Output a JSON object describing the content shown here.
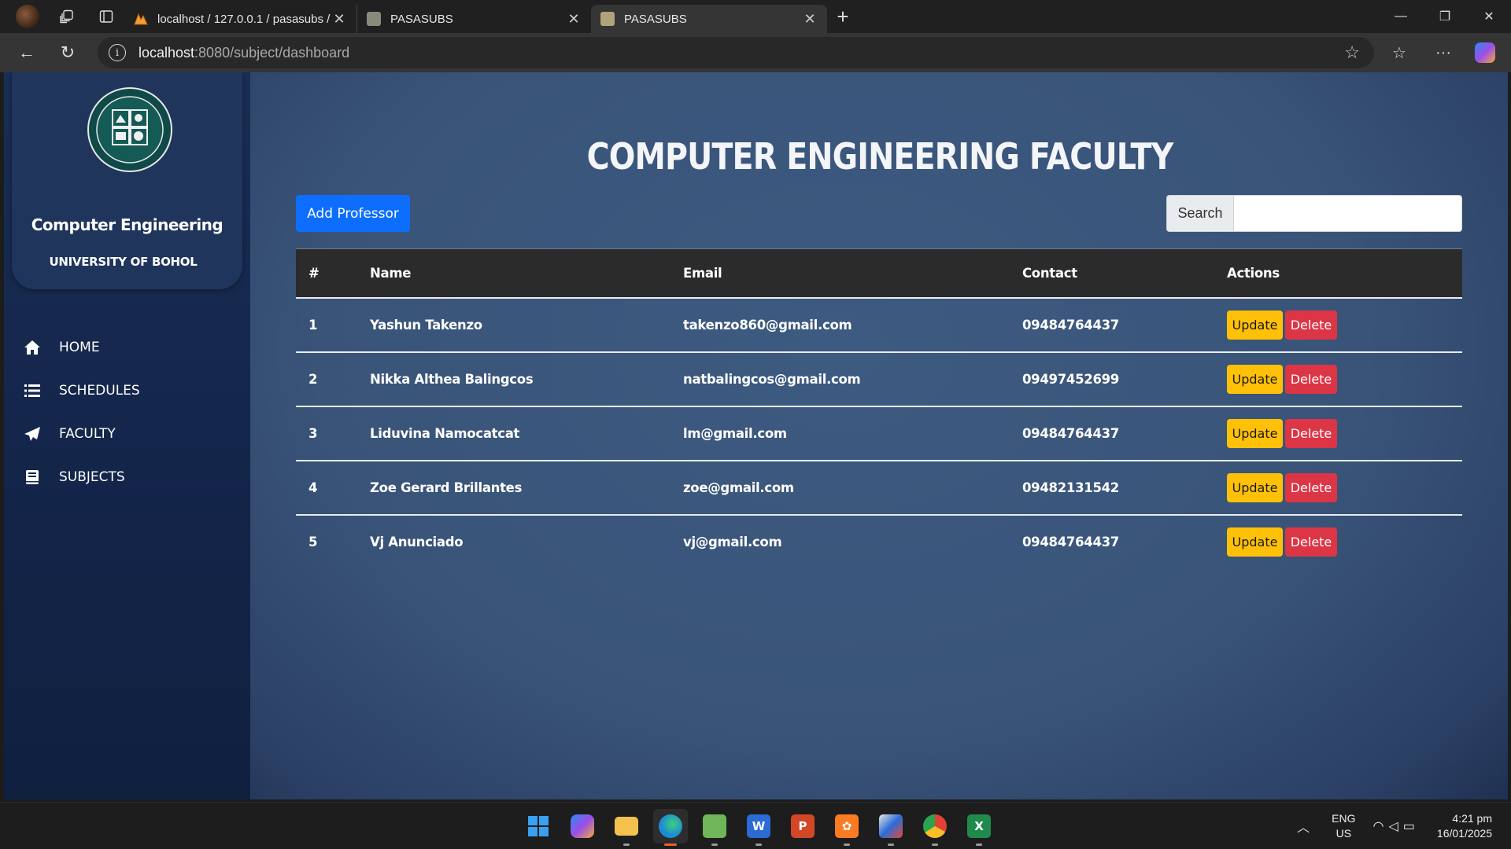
{
  "browser": {
    "tabs": [
      {
        "title": "localhost / 127.0.0.1 / pasasubs / "
      },
      {
        "title": "PASASUBS"
      },
      {
        "title": "PASASUBS"
      }
    ],
    "url_host": "localhost",
    "url_rest": ":8080/subject/dashboard"
  },
  "sidebar": {
    "brand_title": "Computer Engineering",
    "brand_subtitle": "UNIVERSITY OF BOHOL",
    "menu": [
      {
        "label": "HOME",
        "icon": "home-icon"
      },
      {
        "label": "SCHEDULES",
        "icon": "list-icon"
      },
      {
        "label": "FACULTY",
        "icon": "paper-plane-icon"
      },
      {
        "label": "SUBJECTS",
        "icon": "book-icon"
      }
    ]
  },
  "main": {
    "title": "COMPUTER ENGINEERING FACULTY",
    "add_button": "Add Professor",
    "search_label": "Search",
    "search_value": ""
  },
  "table": {
    "headers": [
      "#",
      "Name",
      "Email",
      "Contact",
      "Actions"
    ],
    "rows": [
      {
        "num": "1",
        "name": "Yashun Takenzo",
        "email": "takenzo860@gmail.com",
        "contact": "09484764437"
      },
      {
        "num": "2",
        "name": "Nikka Althea Balingcos",
        "email": "natbalingcos@gmail.com",
        "contact": "09497452699"
      },
      {
        "num": "3",
        "name": "Liduvina Namocatcat",
        "email": "lm@gmail.com",
        "contact": "09484764437"
      },
      {
        "num": "4",
        "name": "Zoe Gerard Brillantes",
        "email": "zoe@gmail.com",
        "contact": "09482131542"
      },
      {
        "num": "5",
        "name": "Vj Anunciado",
        "email": "vj@gmail.com",
        "contact": "09484764437"
      }
    ],
    "update_label": "Update",
    "delete_label": "Delete"
  },
  "taskbar": {
    "lang_line1": "ENG",
    "lang_line2": "US",
    "time": "4:21 pm",
    "date": "16/01/2025"
  },
  "colors": {
    "primary": "#0d6efd",
    "warning": "#ffc107",
    "danger": "#dc3545",
    "sidebar_bg": "#1a2e55",
    "main_bg": "#3d5a80"
  }
}
